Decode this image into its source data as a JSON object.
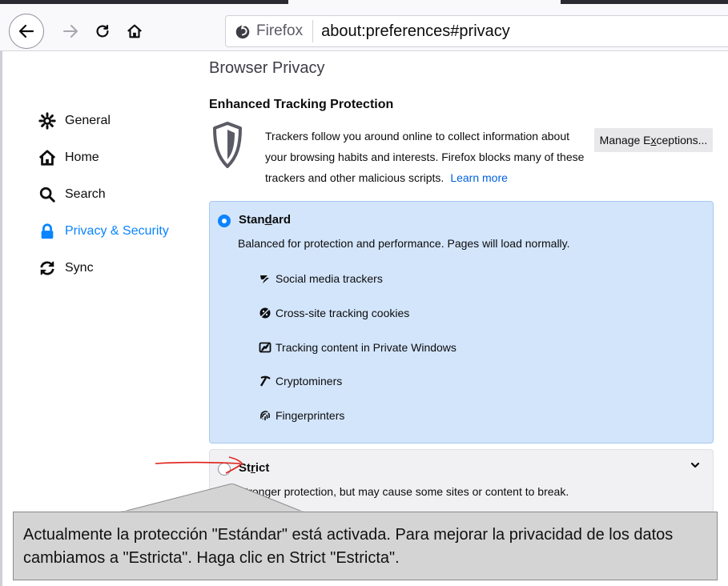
{
  "browser": {
    "identity_label": "Firefox",
    "url": "about:preferences#privacy",
    "icons": [
      "back-arrow-icon",
      "forward-arrow-icon",
      "reload-icon",
      "home-icon",
      "firefox-logo-icon"
    ]
  },
  "sidebar": {
    "items": [
      {
        "label": "General",
        "icon": "gear-icon"
      },
      {
        "label": "Home",
        "icon": "home-icon"
      },
      {
        "label": "Search",
        "icon": "search-icon"
      },
      {
        "label": "Privacy & Security",
        "icon": "lock-icon",
        "active": true
      },
      {
        "label": "Sync",
        "icon": "sync-icon"
      }
    ]
  },
  "main": {
    "page_title": "Browser Privacy",
    "etp_heading": "Enhanced Tracking Protection",
    "etp_description": "Trackers follow you around online to collect information about your browsing habits and interests. Firefox blocks many of these trackers and other malicious scripts.",
    "learn_more": "Learn more",
    "manage_exceptions_pre": "Manage E",
    "manage_exceptions_key": "x",
    "manage_exceptions_post": "ceptions...",
    "standard": {
      "label_pre": "Stan",
      "label_key": "d",
      "label_post": "ard",
      "selected": true,
      "description": "Balanced for protection and performance. Pages will load normally.",
      "features": [
        {
          "label": "Social media trackers",
          "icon": "social-tracker-icon"
        },
        {
          "label": "Cross-site tracking cookies",
          "icon": "cookie-icon"
        },
        {
          "label": "Tracking content in Private Windows",
          "icon": "tracking-content-icon"
        },
        {
          "label": "Cryptominers",
          "icon": "cryptominer-icon"
        },
        {
          "label": "Fingerprinters",
          "icon": "fingerprint-icon"
        }
      ]
    },
    "strict": {
      "label_pre": "St",
      "label_key": "r",
      "label_post": "ict",
      "selected": false,
      "description": "Stronger protection, but may cause some sites or content to break."
    }
  },
  "callout": {
    "text": "Actualmente la protección \"Estándar\" está activada. Para mejorar la privacidad de los datos cambiamos a \"Estricta\". Haga clic en Strict \"Estricta\"."
  },
  "colors": {
    "accent": "#0a84ff",
    "standard_bg": "#d3e5fb",
    "callout_bg": "#d4d4d4",
    "annotation_arrow": "#e0201c"
  }
}
